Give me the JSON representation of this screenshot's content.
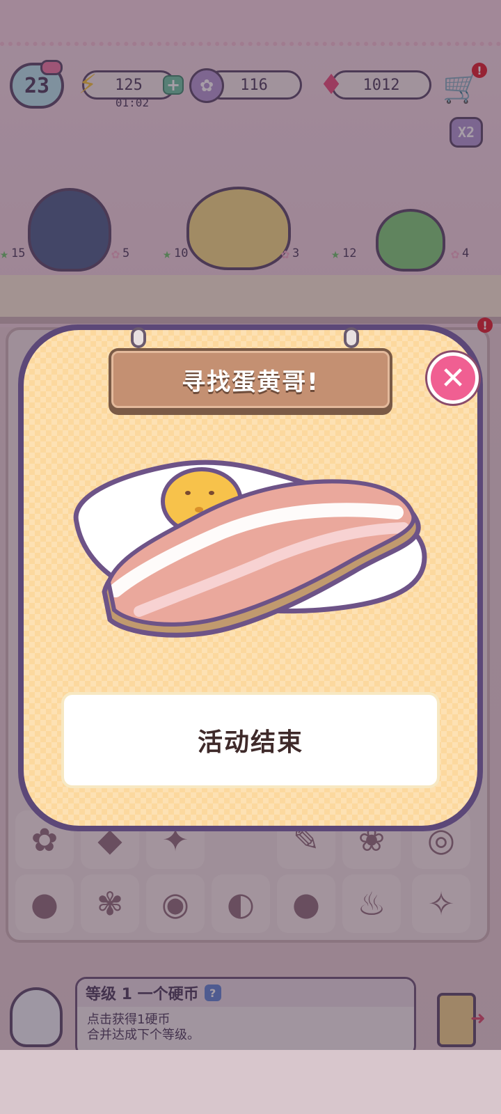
{
  "hud": {
    "level": "23",
    "energy": "125",
    "energy_timer": "01:02",
    "coins": "116",
    "gems": "1012",
    "shop_alert": "!",
    "mail_alert": "!",
    "multiplier": "X2",
    "icons": {
      "energy": "lightning-icon",
      "coins": "hello-kitty-coin-icon",
      "gems": "gem-icon",
      "shop": "cart-icon"
    }
  },
  "orders": {
    "counters": [
      {
        "symbol": "star",
        "value": "15"
      },
      {
        "symbol": "flower",
        "value": "5"
      },
      {
        "symbol": "star",
        "value": "10"
      },
      {
        "symbol": "flower",
        "value": "3"
      },
      {
        "symbol": "star",
        "value": "12"
      },
      {
        "symbol": "flower",
        "value": "4"
      }
    ]
  },
  "modal": {
    "title": "寻找蛋黄哥!",
    "button_label": "活动结束",
    "close_icon": "close-icon",
    "artwork": "gudetama-egg-under-bacon"
  },
  "bottom_panel": {
    "title": "等级 1 一个硬币",
    "help": "?",
    "line1": "点击获得1硬币",
    "line2": "合并达成下个等级。"
  },
  "colors": {
    "modal_border": "#5c4878",
    "modal_fill": "#fcd89e",
    "sign": "#c49072",
    "close_button": "#f05f92",
    "button_text": "#3f2a2a"
  }
}
